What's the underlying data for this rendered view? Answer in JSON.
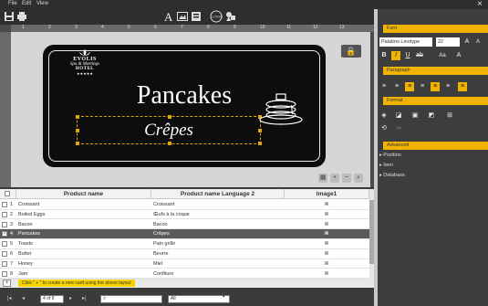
{
  "menu": {
    "file": "File",
    "edit": "Edit",
    "view": "View"
  },
  "card": {
    "logo_line1": "EVOLIS",
    "logo_line2": "Spa & Meetings",
    "logo_line3": "HOTEL",
    "logo_stars": "★★★★★",
    "title": "Pancakes",
    "subtitle": "Crêpes"
  },
  "ruler": [
    "1",
    "2",
    "3",
    "4",
    "5",
    "6",
    "7",
    "8",
    "9",
    "10",
    "11",
    "12",
    "13"
  ],
  "table": {
    "headers": [
      "Product name",
      "Product name Language 2",
      "Image1"
    ],
    "rows": [
      {
        "num": "1",
        "name": "Croissant",
        "lang2": "Croissant",
        "checked": false,
        "selected": false
      },
      {
        "num": "2",
        "name": "Boiled Eggs",
        "lang2": "Œufs à la coque",
        "checked": false,
        "selected": false
      },
      {
        "num": "3",
        "name": "Bacon",
        "lang2": "Bacon",
        "checked": false,
        "selected": false
      },
      {
        "num": "4",
        "name": "Pancakes",
        "lang2": "Crêpes",
        "checked": true,
        "selected": true
      },
      {
        "num": "5",
        "name": "Toasts",
        "lang2": "Pain grillé",
        "checked": false,
        "selected": false
      },
      {
        "num": "6",
        "name": "Butter",
        "lang2": "Beurre",
        "checked": false,
        "selected": false
      },
      {
        "num": "7",
        "name": "Honey",
        "lang2": "Miel",
        "checked": false,
        "selected": false
      },
      {
        "num": "8",
        "name": "Jam",
        "lang2": "Confiture",
        "checked": false,
        "selected": false
      }
    ]
  },
  "hint": "Click \" + \" to create a new card using the above layout",
  "pager": {
    "page": "4 of 8",
    "filter": "All"
  },
  "panel": {
    "font_section": "Font",
    "font_name": "Palatino Linotype",
    "font_size": "22",
    "paragraph_section": "Paragraph",
    "format_section": "Format",
    "advanced_section": "Advanced",
    "advanced_items": [
      "Position",
      "Item",
      "Database"
    ]
  },
  "colors": {
    "accent": "#f0b400",
    "selection": "#5a5a5a"
  }
}
